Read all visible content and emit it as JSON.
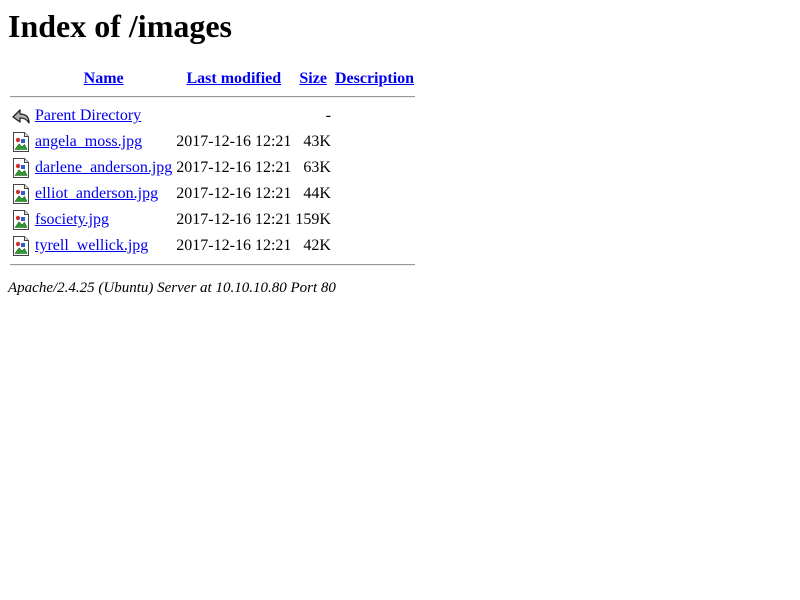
{
  "page_title": "Index of /images",
  "columns": {
    "name": "Name",
    "last_modified": "Last modified",
    "size": "Size",
    "description": "Description"
  },
  "entries": [
    {
      "icon": "back-icon",
      "icon_alt": "[PARENTDIR]",
      "name": "Parent Directory",
      "last_modified": "",
      "size": "-",
      "description": ""
    },
    {
      "icon": "image-icon",
      "icon_alt": "[IMG]",
      "name": "angela_moss.jpg",
      "last_modified": "2017-12-16 12:21",
      "size": "43K",
      "description": ""
    },
    {
      "icon": "image-icon",
      "icon_alt": "[IMG]",
      "name": "darlene_anderson.jpg",
      "last_modified": "2017-12-16 12:21",
      "size": "63K",
      "description": ""
    },
    {
      "icon": "image-icon",
      "icon_alt": "[IMG]",
      "name": "elliot_anderson.jpg",
      "last_modified": "2017-12-16 12:21",
      "size": "44K",
      "description": ""
    },
    {
      "icon": "image-icon",
      "icon_alt": "[IMG]",
      "name": "fsociety.jpg",
      "last_modified": "2017-12-16 12:21",
      "size": "159K",
      "description": ""
    },
    {
      "icon": "image-icon",
      "icon_alt": "[IMG]",
      "name": "tyrell_wellick.jpg",
      "last_modified": "2017-12-16 12:21",
      "size": "42K",
      "description": ""
    }
  ],
  "footer": "Apache/2.4.25 (Ubuntu) Server at 10.10.10.80 Port 80",
  "colors": {
    "link": "#0000ee",
    "text": "#000000",
    "background": "#ffffff"
  }
}
